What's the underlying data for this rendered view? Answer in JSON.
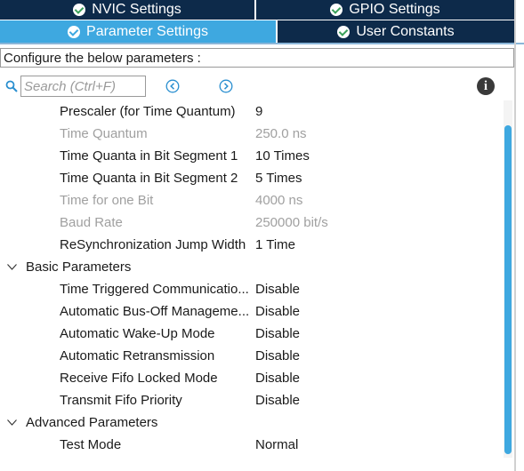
{
  "tabs": {
    "row1": [
      {
        "label": "NVIC Settings",
        "active": false
      },
      {
        "label": "GPIO Settings",
        "active": false
      }
    ],
    "row2": [
      {
        "label": "Parameter Settings",
        "active": true
      },
      {
        "label": "User Constants",
        "active": false
      }
    ]
  },
  "config_label": "Configure the below parameters :",
  "search": {
    "placeholder": "Search (Ctrl+F)",
    "value": ""
  },
  "icons": {
    "search": "search-icon",
    "prev": "chevron-left-circle-icon",
    "next": "chevron-right-circle-icon",
    "info": "info-icon"
  },
  "colors": {
    "active_tab": "#3ea8e0",
    "dark_tab": "#0d2a4a",
    "scroll_thumb": "#3ea8e0"
  },
  "params": [
    {
      "name": "Prescaler (for Time Quantum)",
      "value": "9",
      "enabled": true
    },
    {
      "name": "Time Quantum",
      "value": "250.0 ns",
      "enabled": false
    },
    {
      "name": "Time Quanta in Bit Segment 1",
      "value": "10 Times",
      "enabled": true
    },
    {
      "name": "Time Quanta in Bit Segment 2",
      "value": "5 Times",
      "enabled": true
    },
    {
      "name": "Time for one Bit",
      "value": "4000 ns",
      "enabled": false
    },
    {
      "name": "Baud Rate",
      "value": "250000 bit/s",
      "enabled": false
    },
    {
      "name": "ReSynchronization Jump Width",
      "value": "1 Time",
      "enabled": true
    }
  ],
  "groups": [
    {
      "title": "Basic Parameters",
      "items": [
        {
          "name": "Time Triggered Communicatio...",
          "value": "Disable"
        },
        {
          "name": "Automatic Bus-Off Manageme...",
          "value": "Disable"
        },
        {
          "name": "Automatic Wake-Up Mode",
          "value": "Disable"
        },
        {
          "name": "Automatic Retransmission",
          "value": "Disable"
        },
        {
          "name": "Receive Fifo Locked Mode",
          "value": "Disable"
        },
        {
          "name": "Transmit Fifo Priority",
          "value": "Disable"
        }
      ]
    },
    {
      "title": "Advanced Parameters",
      "items": [
        {
          "name": "Test Mode",
          "value": "Normal"
        }
      ]
    }
  ]
}
